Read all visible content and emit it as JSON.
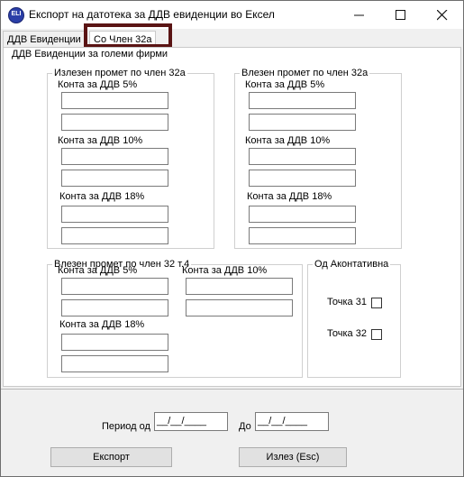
{
  "window": {
    "title": "Експорт на датотека за ДДВ евиденции во Ексел",
    "icon_text": "ELI",
    "minimize_icon": "minimize-icon",
    "maximize_icon": "maximize-icon",
    "close_icon": "close-icon"
  },
  "tabs": [
    {
      "label": "ДДВ Евиденции",
      "active": false
    },
    {
      "label": "Со Член 32а",
      "active": true
    }
  ],
  "panel": {
    "legend": "ДДВ Евиденции за големи фирми",
    "outgoing_32a": {
      "legend": "Излезен промет по член 32а",
      "vat5": "Конта за ДДВ 5%",
      "vat10": "Конта за ДДВ 10%",
      "vat18": "Конта за ДДВ 18%"
    },
    "incoming_32a": {
      "legend": "Влезен промет по член 32а",
      "vat5": "Конта за ДДВ 5%",
      "vat10": "Конта за ДДВ 10%",
      "vat18": "Конта за ДДВ 18%"
    },
    "incoming_32_4": {
      "legend": "Влезен промет по член 32 т.4",
      "vat5": "Конта за ДДВ 5%",
      "vat10": "Конта за ДДВ 10%",
      "vat18": "Конта за ДДВ 18%"
    },
    "advance": {
      "legend": "Од Аконтативна",
      "point31": "Точка 31",
      "point32": "Точка 32"
    }
  },
  "period": {
    "from_label": "Период од",
    "from_value": "__/__/____",
    "to_label": "До",
    "to_value": "__/__/____"
  },
  "buttons": {
    "export": "Експорт",
    "exit": "Излез (Esc)"
  }
}
